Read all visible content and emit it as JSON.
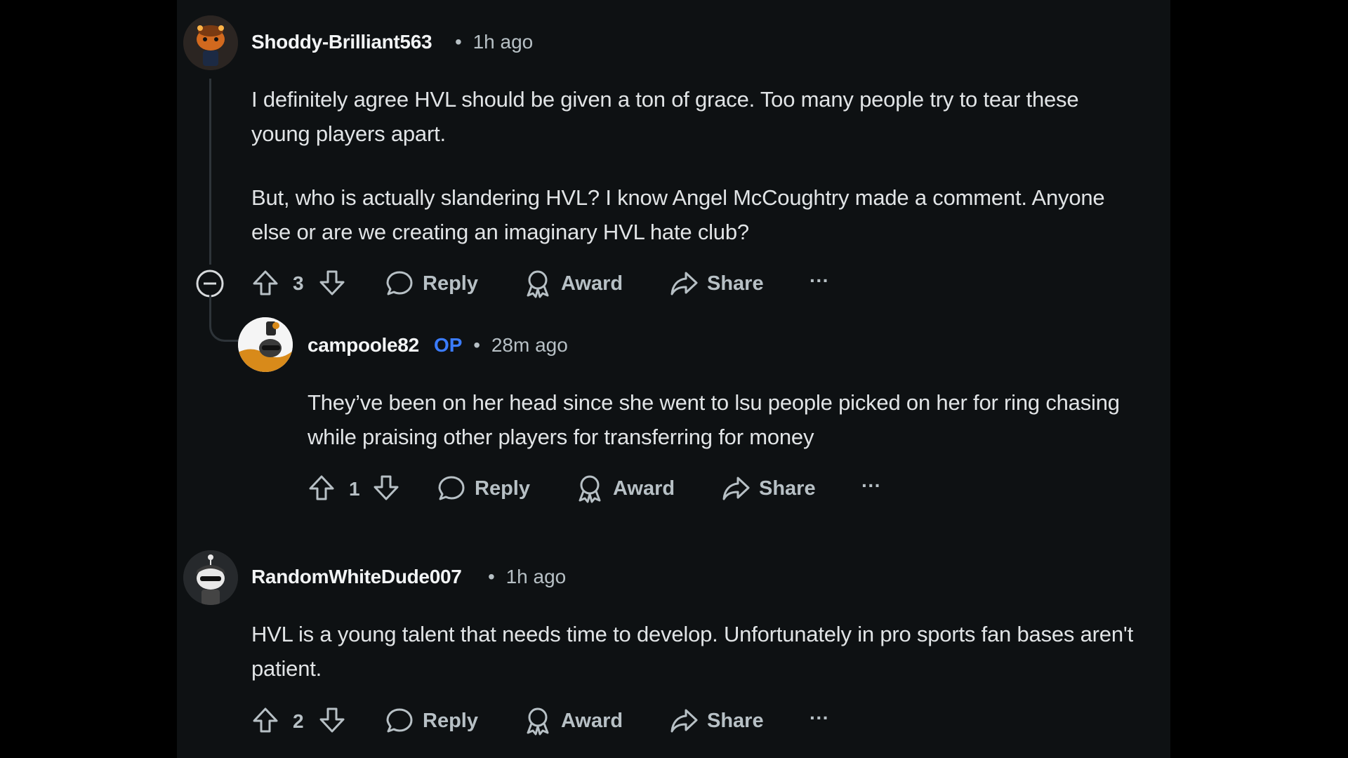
{
  "colors": {
    "background": "#000000",
    "panel": "#0e1113",
    "text": "#e1e4e6",
    "meta": "#b7c0c5",
    "op_badge": "#3b7cff"
  },
  "comments": [
    {
      "author": "Shoddy-Brilliant563",
      "time": "1h ago",
      "paragraphs": [
        "I definitely agree HVL should be given a ton of grace. Too many people try to tear these young players apart.",
        "But, who is actually slandering HVL? I know Angel McCoughtry made a comment. Anyone else or are we creating an imaginary HVL hate club?"
      ],
      "score": "3",
      "actions": {
        "reply": "Reply",
        "award": "Award",
        "share": "Share",
        "more": "···"
      }
    },
    {
      "author": "campoole82",
      "badge": "OP",
      "time": "28m ago",
      "paragraphs": [
        "They’ve been on her head since she went to lsu people picked on her for ring chasing while praising other players for transferring for money"
      ],
      "score": "1",
      "actions": {
        "reply": "Reply",
        "award": "Award",
        "share": "Share",
        "more": "···"
      }
    },
    {
      "author": "RandomWhiteDude007",
      "time": "1h ago",
      "paragraphs": [
        "HVL is a young talent that needs time to develop. Unfortunately in pro sports fan bases aren't patient."
      ],
      "score": "2",
      "actions": {
        "reply": "Reply",
        "award": "Award",
        "share": "Share",
        "more": "···"
      }
    }
  ],
  "separator": "•"
}
